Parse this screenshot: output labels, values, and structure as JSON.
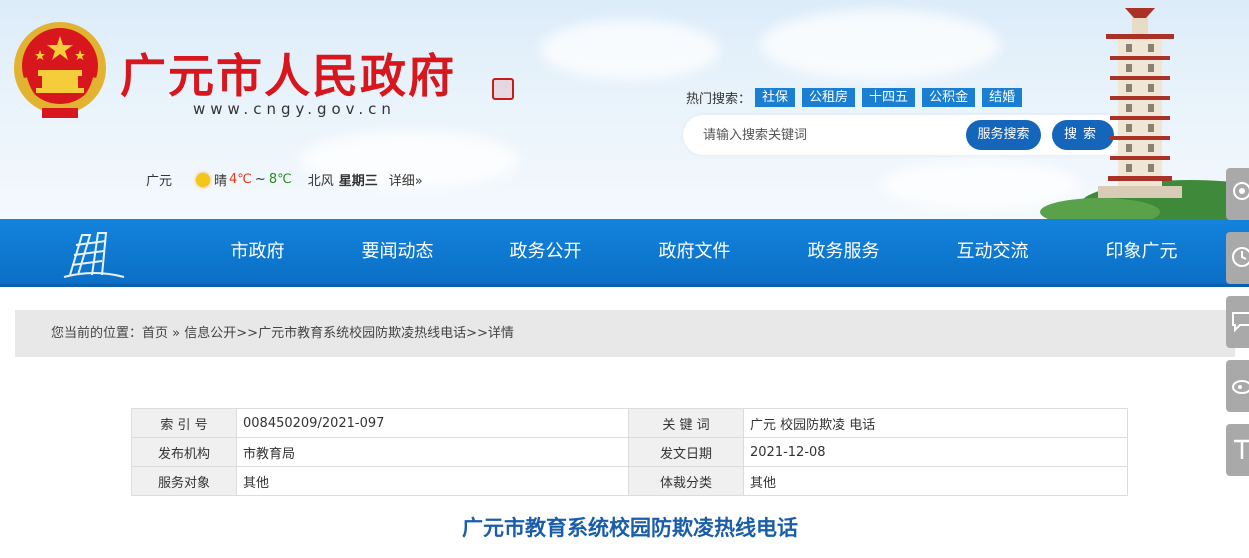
{
  "header": {
    "site_title": "广元市人民政府",
    "site_url": "www.cngy.gov.cn",
    "weather": {
      "city": "广元",
      "condition": "晴",
      "temp_low": "4℃",
      "tilde": "~",
      "temp_high": "8℃",
      "wind": "北风",
      "weekday": "星期三",
      "detail_link": "详细»"
    },
    "hot_search": {
      "label": "热门搜索：",
      "tags": [
        "社保",
        "公租房",
        "十四五",
        "公积金",
        "结婚"
      ]
    },
    "search": {
      "placeholder": "请输入搜索关键词",
      "service_button": "服务搜索",
      "search_button": "搜索"
    }
  },
  "nav": {
    "items": [
      "市政府",
      "要闻动态",
      "政务公开",
      "政府文件",
      "政务服务",
      "互动交流",
      "印象广元"
    ]
  },
  "breadcrumb": {
    "prefix": "您当前的位置：",
    "home": "首页",
    "sep1": " » ",
    "section": "信息公开",
    "sep2": ">>",
    "topic": "广元市教育系统校园防欺凌热线电话",
    "sep3": ">>",
    "current": "详情"
  },
  "info": {
    "rows": [
      {
        "k1": "索 引 号",
        "v1": "008450209/2021-097",
        "k2": "关 键 词",
        "v2": "广元 校园防欺凌 电话"
      },
      {
        "k1": "发布机构",
        "v1": "市教育局",
        "k2": "发文日期",
        "v2": "2021-12-08"
      },
      {
        "k1": "服务对象",
        "v1": "其他",
        "k2": "体裁分类",
        "v2": "其他"
      }
    ]
  },
  "article": {
    "title": "广元市教育系统校园防欺凌热线电话"
  },
  "colors": {
    "brand_red": "#d7161e",
    "nav_blue": "#0b6fc6",
    "button_blue": "#1566ba",
    "title_blue": "#1a5da8"
  },
  "icons": {
    "emblem": "national-emblem-icon",
    "nav_logo": "gate-logo-icon",
    "sun": "sun-icon",
    "side": [
      "service-icon",
      "clock-icon",
      "chat-icon",
      "weibo-icon",
      "text-size-icon"
    ]
  }
}
